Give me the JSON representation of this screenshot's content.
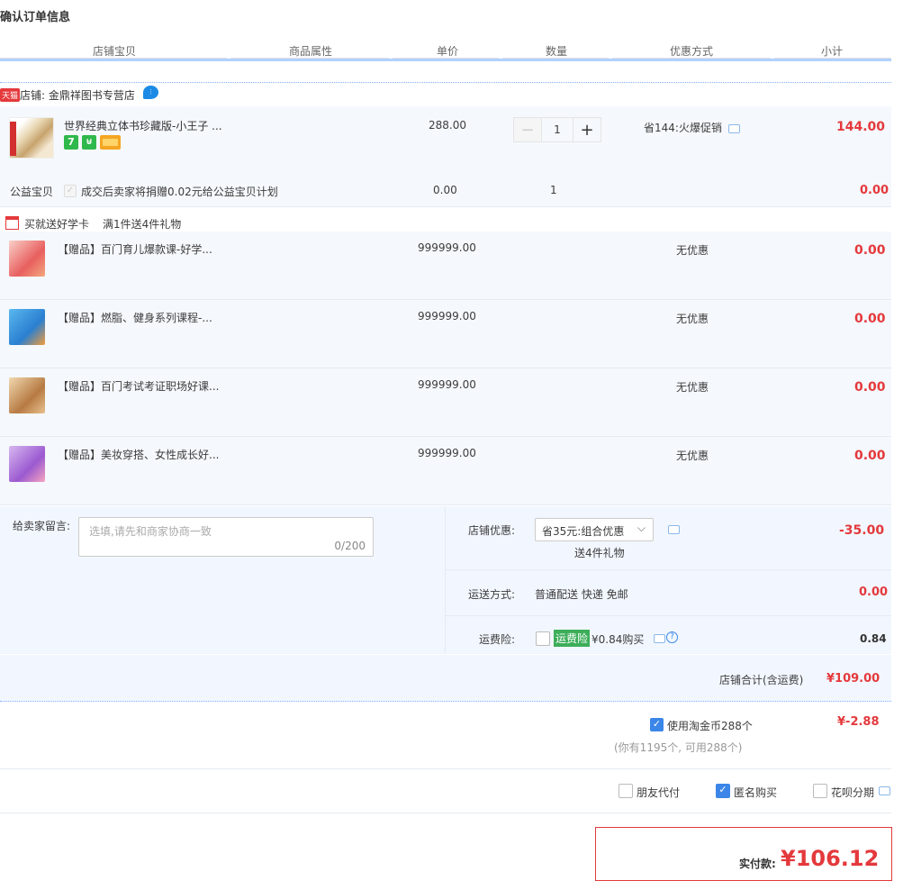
{
  "page_title": "确认订单信息",
  "headers": {
    "item": "店铺宝贝",
    "attr": "商品属性",
    "price": "单价",
    "qty": "数量",
    "discount": "优惠方式",
    "subtotal": "小计"
  },
  "shop": {
    "tag": "天猫",
    "name": "店铺: 金鼎祥图书专营店"
  },
  "product": {
    "title": "世界经典立体书珍藏版-小王子 ...",
    "price": "288.00",
    "qty": "1",
    "minus": "−",
    "plus": "+",
    "promo": "省144:火爆促销",
    "subtotal": "144.00",
    "badges": [
      "7"
    ]
  },
  "charity": {
    "label": "公益宝贝",
    "text": "成交后卖家将捐赠0.02元给公益宝贝计划",
    "price": "0.00",
    "qty": "1",
    "subtotal": "0.00"
  },
  "gift_promo": {
    "label": "买就送好学卡",
    "text": "满1件送4件礼物"
  },
  "gifts": [
    {
      "title": "【赠品】百门育儿爆款课-好学...",
      "price": "999999.00",
      "discount": "无优惠",
      "subtotal": "0.00"
    },
    {
      "title": "【赠品】燃脂、健身系列课程-...",
      "price": "999999.00",
      "discount": "无优惠",
      "subtotal": "0.00"
    },
    {
      "title": "【赠品】百门考试考证职场好课...",
      "price": "999999.00",
      "discount": "无优惠",
      "subtotal": "0.00"
    },
    {
      "title": "【赠品】美妆穿搭、女性成长好...",
      "price": "999999.00",
      "discount": "无优惠",
      "subtotal": "0.00"
    }
  ],
  "message": {
    "label": "给卖家留言:",
    "placeholder": "选填,请先和商家协商一致",
    "counter": "0/200"
  },
  "shop_discount": {
    "label": "店铺优惠:",
    "value": "省35元:组合优惠",
    "note": "送4件礼物",
    "amount": "-35.00"
  },
  "shipping": {
    "label": "运送方式:",
    "value": "普通配送 快递 免邮",
    "amount": "0.00"
  },
  "insurance": {
    "label": "运费险:",
    "tag": "运费险",
    "value": "¥0.84购买",
    "amount": "0.84"
  },
  "shop_total": {
    "label": "店铺合计(含运费)",
    "amount": "¥109.00"
  },
  "coins": {
    "label": "使用淘金币288个",
    "note": "(你有1195个, 可用288个)",
    "amount": "¥-2.88"
  },
  "options": {
    "friend_pay": "朋友代付",
    "anonymous": "匿名购买",
    "huabei": "花呗分期"
  },
  "final": {
    "label": "实付款:",
    "amount": "¥106.12"
  },
  "colors": {
    "accent_red": "#e4393c",
    "blue": "#3b86e8",
    "bg_light": "#f5f8fc"
  }
}
